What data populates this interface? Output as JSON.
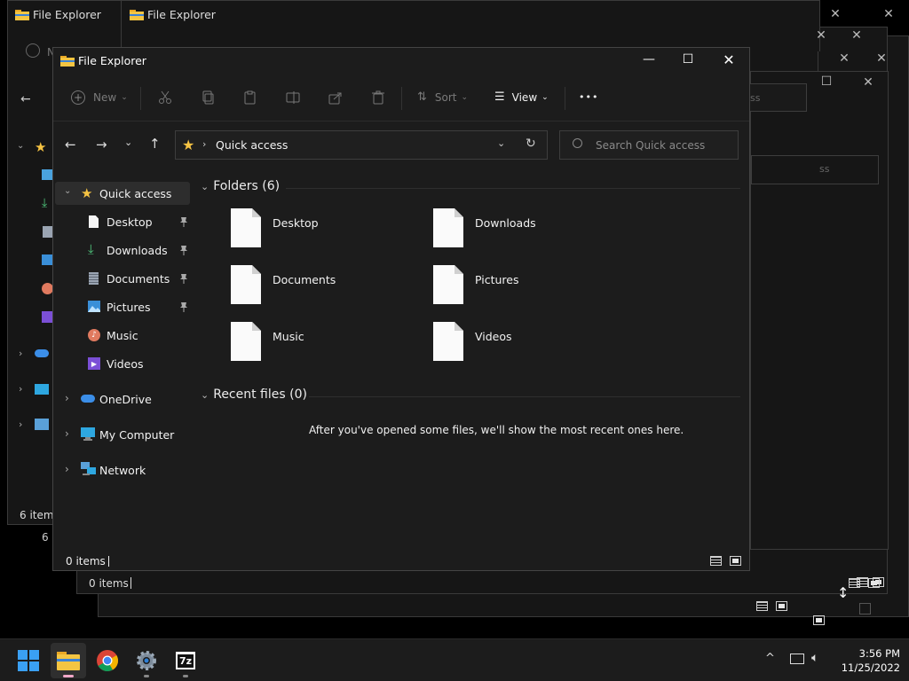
{
  "window": {
    "title": "File Explorer",
    "back_title_1": "File Explorer",
    "back_title_2": "File Explorer"
  },
  "toolbar": {
    "new_label": "New",
    "sort_label": "Sort",
    "view_label": "View",
    "more_label": "•••"
  },
  "address": {
    "location": "Quick access",
    "search_placeholder": "Search Quick access"
  },
  "nav": {
    "quick_access": "Quick access",
    "items": [
      {
        "label": "Desktop",
        "pinned": true
      },
      {
        "label": "Downloads",
        "pinned": true
      },
      {
        "label": "Documents",
        "pinned": true
      },
      {
        "label": "Pictures",
        "pinned": true
      },
      {
        "label": "Music",
        "pinned": false
      },
      {
        "label": "Videos",
        "pinned": false
      }
    ],
    "onedrive": "OneDrive",
    "my_computer": "My Computer",
    "network": "Network"
  },
  "content": {
    "folders_header": "Folders (6)",
    "folders": [
      "Desktop",
      "Downloads",
      "Documents",
      "Pictures",
      "Music",
      "Videos"
    ],
    "recent_header": "Recent files (0)",
    "recent_empty": "After you've opened some files, we'll show the most recent ones here."
  },
  "status": {
    "main_items": "0 items",
    "back_items_1": "6 items",
    "back_items_2": "6 i",
    "back_items_3": "0 items"
  },
  "back_search_fragment_1": "ss",
  "back_search_fragment_2": "ss",
  "back_nav_button_fragment": "N",
  "taskbar": {
    "time": "3:56 PM",
    "date": "11/25/2022",
    "seven_zip_label": "7z"
  },
  "colors": {
    "accent_blue": "#0078d4",
    "folder_yellow": "#f4c542",
    "star_yellow": "#f6c343",
    "selected_nav": "#2d2d2d"
  }
}
